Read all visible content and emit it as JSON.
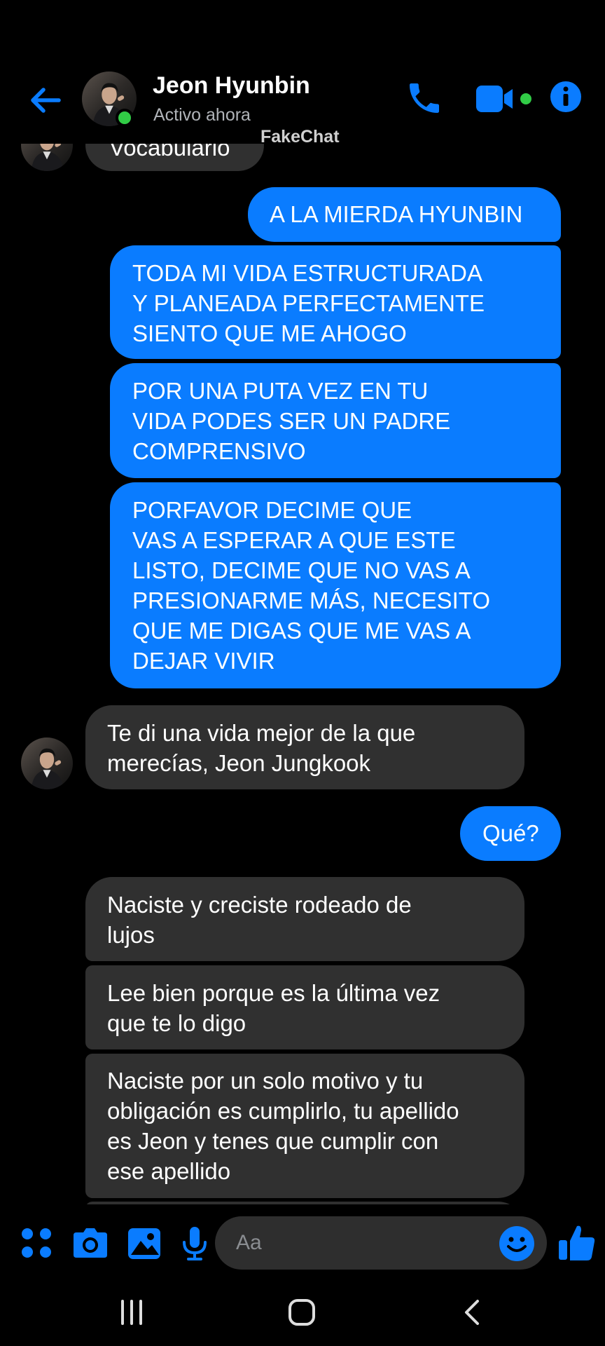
{
  "header": {
    "contact_name": "Jeon Hyunbin",
    "status": "Activo ahora",
    "icons": [
      "arrow-left-icon",
      "avatar",
      "phone-icon",
      "video-camera-icon",
      "info-icon"
    ]
  },
  "watermark": "FakeChat",
  "messages": [
    {
      "direction": "incoming",
      "text": "Vocabulario"
    },
    {
      "direction": "outgoing",
      "text": "A LA MIERDA HYUNBIN"
    },
    {
      "direction": "outgoing",
      "text": "TODA MI VIDA ESTRUCTURADA\nY PLANEADA PERFECTAMENTE\nSIENTO QUE ME AHOGO"
    },
    {
      "direction": "outgoing",
      "text": "POR UNA PUTA VEZ EN TU\nVIDA PODES SER UN PADRE\nCOMPRENSIVO"
    },
    {
      "direction": "outgoing",
      "text": "PORFAVOR DECIME QUE\nVAS A ESPERAR A QUE ESTE\nLISTO, DECIME QUE NO VAS A\nPRESIONARME MÁS, NECESITO\nQUE ME DIGAS QUE ME VAS A\nDEJAR VIVIR"
    },
    {
      "direction": "incoming",
      "text": "Te di una vida mejor de la que\nmerecías, Jeon Jungkook"
    },
    {
      "direction": "outgoing",
      "text": "Qué?"
    },
    {
      "direction": "incoming",
      "text": "Naciste y creciste rodeado de\nlujos"
    },
    {
      "direction": "incoming",
      "text": "Lee bien porque es la última vez\nque te lo digo"
    },
    {
      "direction": "incoming",
      "text": "Naciste por un solo motivo y tu\nobligación es cumplirlo, tu apellido\nes Jeon y tenes que cumplir con\nese apellido"
    }
  ],
  "composer": {
    "placeholder": "Aa",
    "icons": [
      "apps-grid-icon",
      "camera-icon",
      "gallery-icon",
      "microphone-icon",
      "emoji-icon",
      "thumbs-up-icon"
    ]
  },
  "navbar": {
    "icons": [
      "recent-apps-icon",
      "home-icon",
      "back-icon"
    ]
  },
  "colors": {
    "accent": "#0a7cff",
    "background": "#000000",
    "incoming_bubble": "#303030",
    "online": "#31cc46"
  }
}
